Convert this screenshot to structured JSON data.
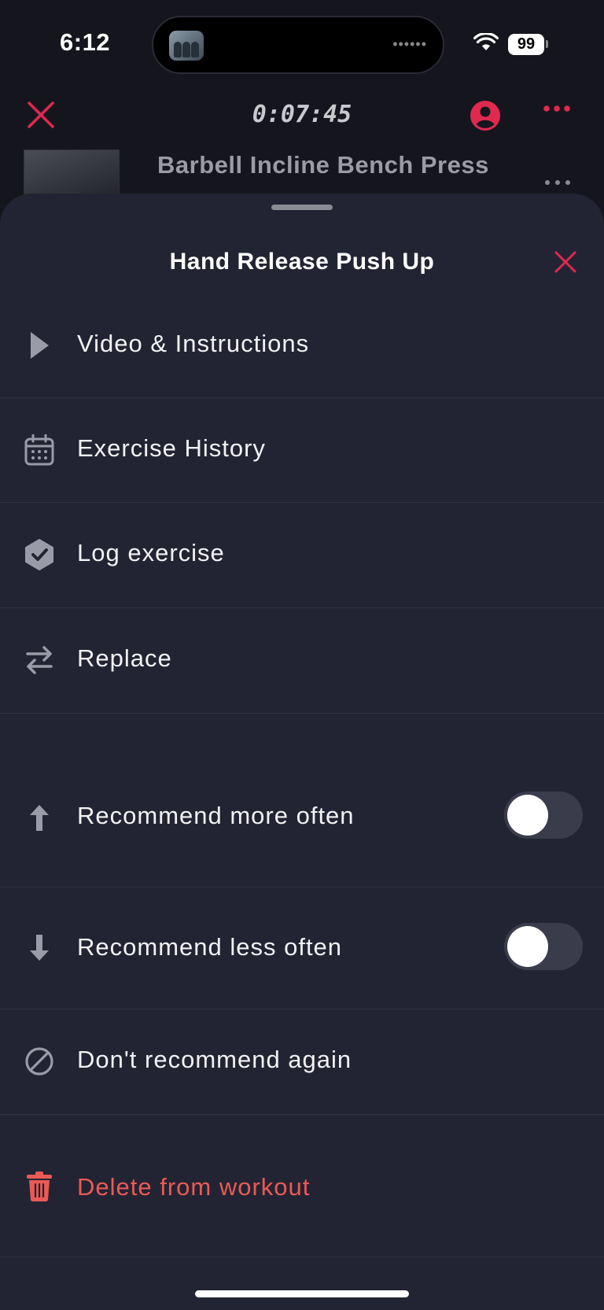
{
  "status_bar": {
    "time": "6:12",
    "battery": "99"
  },
  "workout_header": {
    "timer": "0:07:45",
    "current_exercise": "Barbell Incline Bench Press"
  },
  "sheet": {
    "title": "Hand Release Push Up",
    "actions": [
      {
        "label": "Video & Instructions",
        "icon": "play-icon"
      },
      {
        "label": "Exercise History",
        "icon": "calendar-icon"
      },
      {
        "label": "Log exercise",
        "icon": "check-badge-icon"
      },
      {
        "label": "Replace",
        "icon": "swap-arrows-icon"
      }
    ],
    "preferences": [
      {
        "label": "Recommend more often",
        "icon": "arrow-up-icon",
        "enabled": false
      },
      {
        "label": "Recommend less often",
        "icon": "arrow-down-icon",
        "enabled": false
      },
      {
        "label": "Don't recommend again",
        "icon": "block-icon"
      }
    ],
    "delete_label": "Delete from workout"
  },
  "colors": {
    "accent": "#e0294f",
    "danger_text": "#ea5a55",
    "sheet_background": "#232433",
    "icon_gray": "#9a9ba8"
  }
}
